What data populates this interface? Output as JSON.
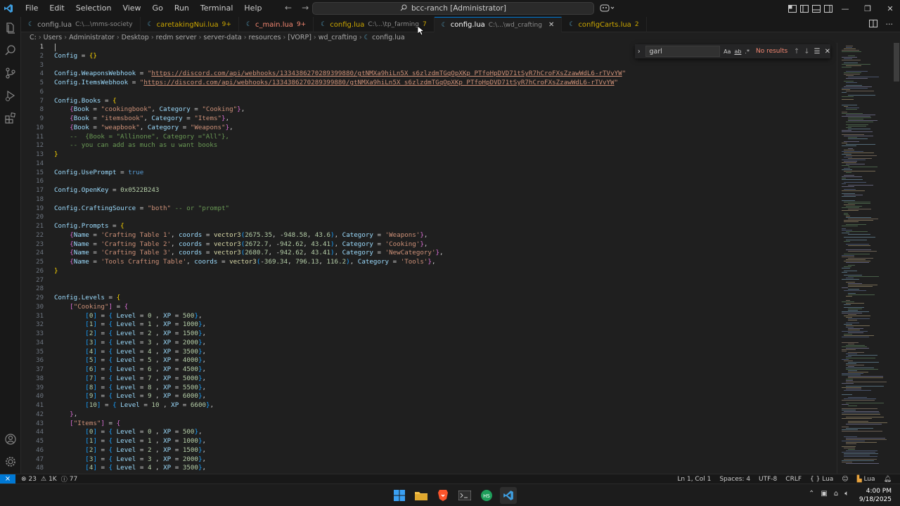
{
  "menu": [
    "File",
    "Edit",
    "Selection",
    "View",
    "Go",
    "Run",
    "Terminal",
    "Help"
  ],
  "command_center": "bcc-ranch [Administrator]",
  "tabs": [
    {
      "name": "config.lua",
      "desc": "C:\\...\\mms-society",
      "badge": "",
      "state": "normal"
    },
    {
      "name": "caretakingNui.lua",
      "desc": "",
      "badge": "9+",
      "state": "mod"
    },
    {
      "name": "c_main.lua",
      "desc": "",
      "badge": "9+",
      "state": "err"
    },
    {
      "name": "config.lua",
      "desc": "C:\\...\\tp_farming",
      "badge": "7",
      "state": "mod"
    },
    {
      "name": "config.lua",
      "desc": "C:\\...\\wd_crafting",
      "badge": "",
      "state": "active"
    },
    {
      "name": "configCarts.lua",
      "desc": "",
      "badge": "2",
      "state": "mod"
    }
  ],
  "breadcrumb": [
    "C:",
    "Users",
    "Administrator",
    "Desktop",
    "redm server",
    "server-data",
    "resources",
    "[VORP]",
    "wd_crafting",
    "config.lua"
  ],
  "find": {
    "query": "garl",
    "result": "No results",
    "opt_case": "Aa",
    "opt_word": "ab",
    "opt_regex": ".*"
  },
  "editor": {
    "language": "lua"
  },
  "status": {
    "errors": "23",
    "warnings": "1K",
    "info": "77",
    "position": "Ln 1, Col 1",
    "spaces": "Spaces: 4",
    "encoding": "UTF-8",
    "eol": "CRLF",
    "language": "Lua",
    "lang2": "Lua"
  },
  "taskbar": {
    "time": "4:00 PM",
    "date": "9/18/2025"
  },
  "colors": {
    "accent": "#0078d4",
    "error": "#f48771",
    "warning": "#cca700",
    "background": "#1f1f1f"
  },
  "icons": {
    "activity": [
      "explorer-icon",
      "search-icon",
      "source-control-icon",
      "run-debug-icon",
      "extensions-icon"
    ],
    "activity_bottom": [
      "accounts-icon",
      "settings-gear-icon"
    ]
  }
}
